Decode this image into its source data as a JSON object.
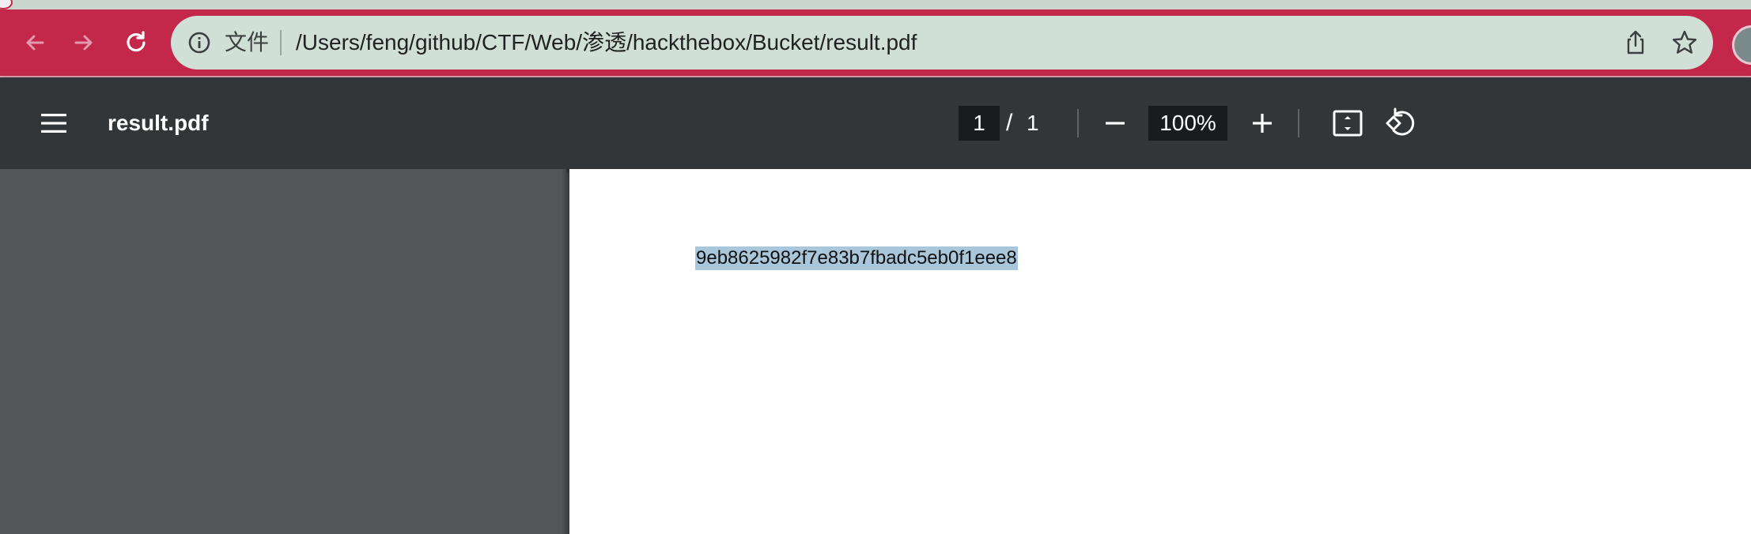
{
  "browser": {
    "scheme_label": "文件",
    "url": "/Users/feng/github/CTF/Web/渗透/hackthebox/Bucket/result.pdf",
    "theme_color": "#c3284a",
    "icons": [
      "back-arrow-icon",
      "forward-arrow-icon",
      "reload-icon",
      "info-icon",
      "share-icon",
      "star-icon",
      "extension-icon"
    ]
  },
  "pdf_viewer": {
    "title": "result.pdf",
    "current_page": "1",
    "page_separator": "/",
    "total_pages": "1",
    "zoom": "100%",
    "icons": [
      "menu-icon",
      "zoom-out-icon",
      "zoom-in-icon",
      "fit-page-icon",
      "rotate-icon"
    ]
  },
  "document": {
    "text": "9eb8625982f7e83b7fbadc5eb0f1eee8",
    "text_selected": true
  }
}
